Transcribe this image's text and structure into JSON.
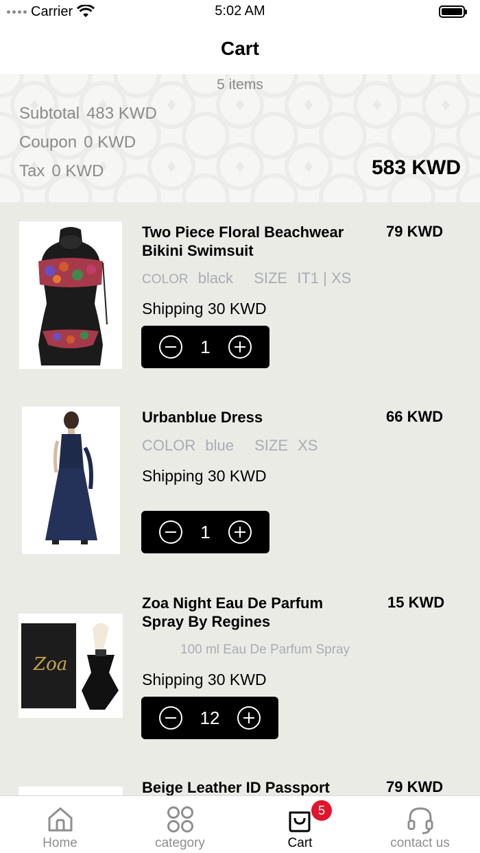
{
  "status_bar": {
    "carrier": "Carrier",
    "time": "5:02 AM"
  },
  "nav": {
    "title": "Cart"
  },
  "summary": {
    "items_count": "5 items",
    "subtotal_label": "Subtotal",
    "subtotal_value": "483 KWD",
    "coupon_label": "Coupon",
    "coupon_value": "0 KWD",
    "tax_label": "Tax",
    "tax_value": "0 KWD",
    "total": "583 KWD"
  },
  "items": [
    {
      "name": "Two Piece Floral Beachwear Bikini Swimsuit",
      "price": "79 KWD",
      "color_label": "COLOR",
      "color_value": "black",
      "size_label": "SIZE",
      "size_value": "IT1 | XS",
      "shipping_label": "Shipping",
      "shipping_value": "30 KWD",
      "quantity": "1"
    },
    {
      "name": "Urbanblue Dress",
      "price": "66 KWD",
      "color_label": "COLOR",
      "color_value": "blue",
      "size_label": "SIZE",
      "size_value": "XS",
      "shipping_label": "Shipping",
      "shipping_value": "30 KWD",
      "quantity": "1"
    },
    {
      "name": "Zoa Night Eau De Parfum Spray By Regines",
      "price": "15 KWD",
      "variant": "100 ml Eau De Parfum Spray",
      "shipping_label": "Shipping",
      "shipping_value": "30 KWD",
      "quantity": "12"
    },
    {
      "name": "Beige Leather ID Passport",
      "price": "79 KWD"
    }
  ],
  "perfume_box_text": "Zoa",
  "tabbar": {
    "tabs": [
      {
        "label": "Home",
        "icon": "home-icon"
      },
      {
        "label": "category",
        "icon": "category-grid-icon"
      },
      {
        "label": "Cart",
        "icon": "shopping-bag-icon",
        "badge": "5"
      },
      {
        "label": "contact us",
        "icon": "headset-icon"
      }
    ]
  },
  "colors": {
    "accent": "#000000",
    "badge": "#e0142c",
    "muted": "#a8adb4",
    "list_bg": "#ebebe6"
  }
}
